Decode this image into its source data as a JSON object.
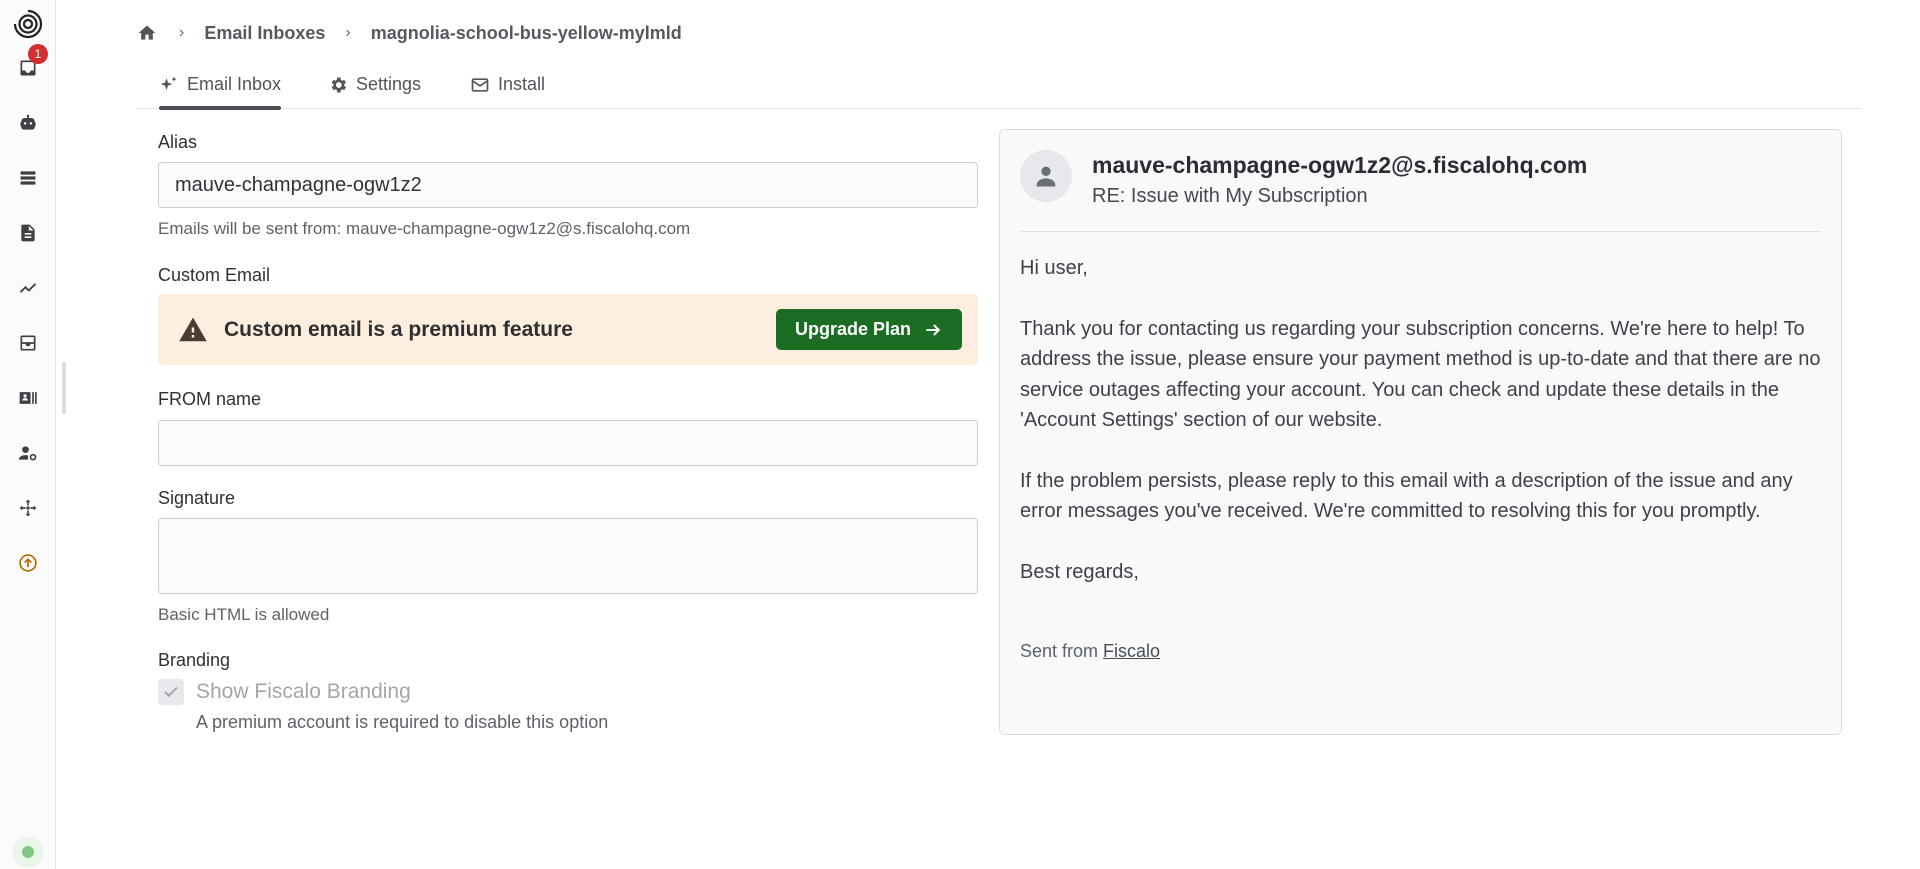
{
  "sidebar": {
    "notification_count": "1",
    "items": [
      {
        "icon": "inbox-icon"
      },
      {
        "icon": "robot-icon"
      },
      {
        "icon": "list-icon"
      },
      {
        "icon": "document-icon"
      },
      {
        "icon": "chart-line-icon"
      },
      {
        "icon": "tray-icon"
      },
      {
        "icon": "contact-card-icon"
      },
      {
        "icon": "user-settings-icon"
      },
      {
        "icon": "move-icon"
      },
      {
        "icon": "upgrade-icon"
      }
    ],
    "accent_color": "#d32f2f"
  },
  "breadcrumb": {
    "items": [
      "Email Inboxes",
      "magnolia-school-bus-yellow-mylmld"
    ]
  },
  "tabs": [
    {
      "label": "Email Inbox",
      "icon": "sparkle-icon",
      "active": true
    },
    {
      "label": "Settings",
      "icon": "gear-icon",
      "active": false
    },
    {
      "label": "Install",
      "icon": "mail-icon",
      "active": false
    }
  ],
  "form": {
    "alias_label": "Alias",
    "alias_value": "mauve-champagne-ogw1z2",
    "alias_help": "Emails will be sent from: mauve-champagne-ogw1z2@s.fiscalohq.com",
    "custom_email_label": "Custom Email",
    "premium_text": "Custom email is a premium feature",
    "upgrade_label": "Upgrade Plan",
    "from_name_label": "FROM name",
    "from_name_value": "",
    "signature_label": "Signature",
    "signature_value": "",
    "signature_help": "Basic HTML is allowed",
    "branding_label": "Branding",
    "branding_checkbox_label": "Show Fiscalo Branding",
    "branding_checked": true,
    "branding_help": "A premium account is required to disable this option",
    "upgrade_color": "#1b6d23",
    "premium_bg": "#fdeee0"
  },
  "preview": {
    "from": "mauve-champagne-ogw1z2@s.fiscalohq.com",
    "subject": "RE: Issue with My Subscription",
    "greeting": "Hi user,",
    "paragraph1": "Thank you for contacting us regarding your subscription concerns. We're here to help! To address the issue, please ensure your payment method is up-to-date and that there are no service outages affecting your account. You can check and update these details in the 'Account Settings' section of our website.",
    "paragraph2": "If the problem persists, please reply to this email with a description of the issue and any error messages you've received. We're committed to resolving this for you promptly.",
    "closing": "Best regards,",
    "sent_from_prefix": "Sent from",
    "sent_from_link": "Fiscalo"
  }
}
